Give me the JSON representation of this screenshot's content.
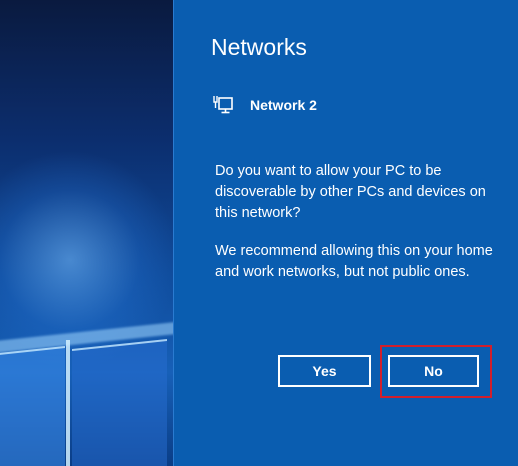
{
  "panel": {
    "title": "Networks",
    "network": {
      "name": "Network 2",
      "icon": "ethernet-network-icon"
    },
    "message_1": "Do you want to allow your PC to be discoverable by other PCs and devices on this network?",
    "message_2": "We recommend allowing this on your home and work networks, but not public ones.",
    "yes_label": "Yes",
    "no_label": "No"
  },
  "colors": {
    "panel_background": "#0a5db0",
    "text": "#ffffff",
    "highlight": "#d21f2b"
  }
}
